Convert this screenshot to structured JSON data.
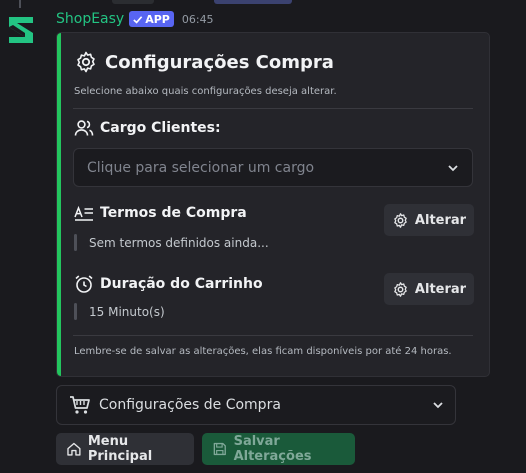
{
  "message": {
    "author": "ShopEasy",
    "badge": "APP",
    "time": "06:45"
  },
  "colors": {
    "author": "#23c483",
    "badge": "#5865f2",
    "accent": "#23c55e",
    "save_button": "#1a5a3a"
  },
  "embed": {
    "title": "Configurações Compra",
    "description": "Selecione abaixo quais configurações deseja alterar.",
    "fields": [
      {
        "icon": "users-icon",
        "title": "Cargo Clientes:",
        "select_placeholder": "Clique para selecionar um cargo"
      },
      {
        "icon": "text-lines-icon",
        "title": "Termos de Compra",
        "value": "Sem termos definidos ainda...",
        "button_label": "Alterar"
      },
      {
        "icon": "alarm-clock-icon",
        "title": "Duração do Carrinho",
        "value": "15 Minuto(s)",
        "button_label": "Alterar"
      }
    ],
    "footer": "Lembre-se de salvar as alterações, elas ficam disponíveis por até 24 horas."
  },
  "components": {
    "menu_select": {
      "icon": "cart-icon",
      "selected": "Configurações de Compra"
    },
    "buttons": [
      {
        "icon": "home-icon",
        "label": "Menu Principal"
      },
      {
        "icon": "save-icon",
        "label": "Salvar Alterações"
      }
    ]
  }
}
